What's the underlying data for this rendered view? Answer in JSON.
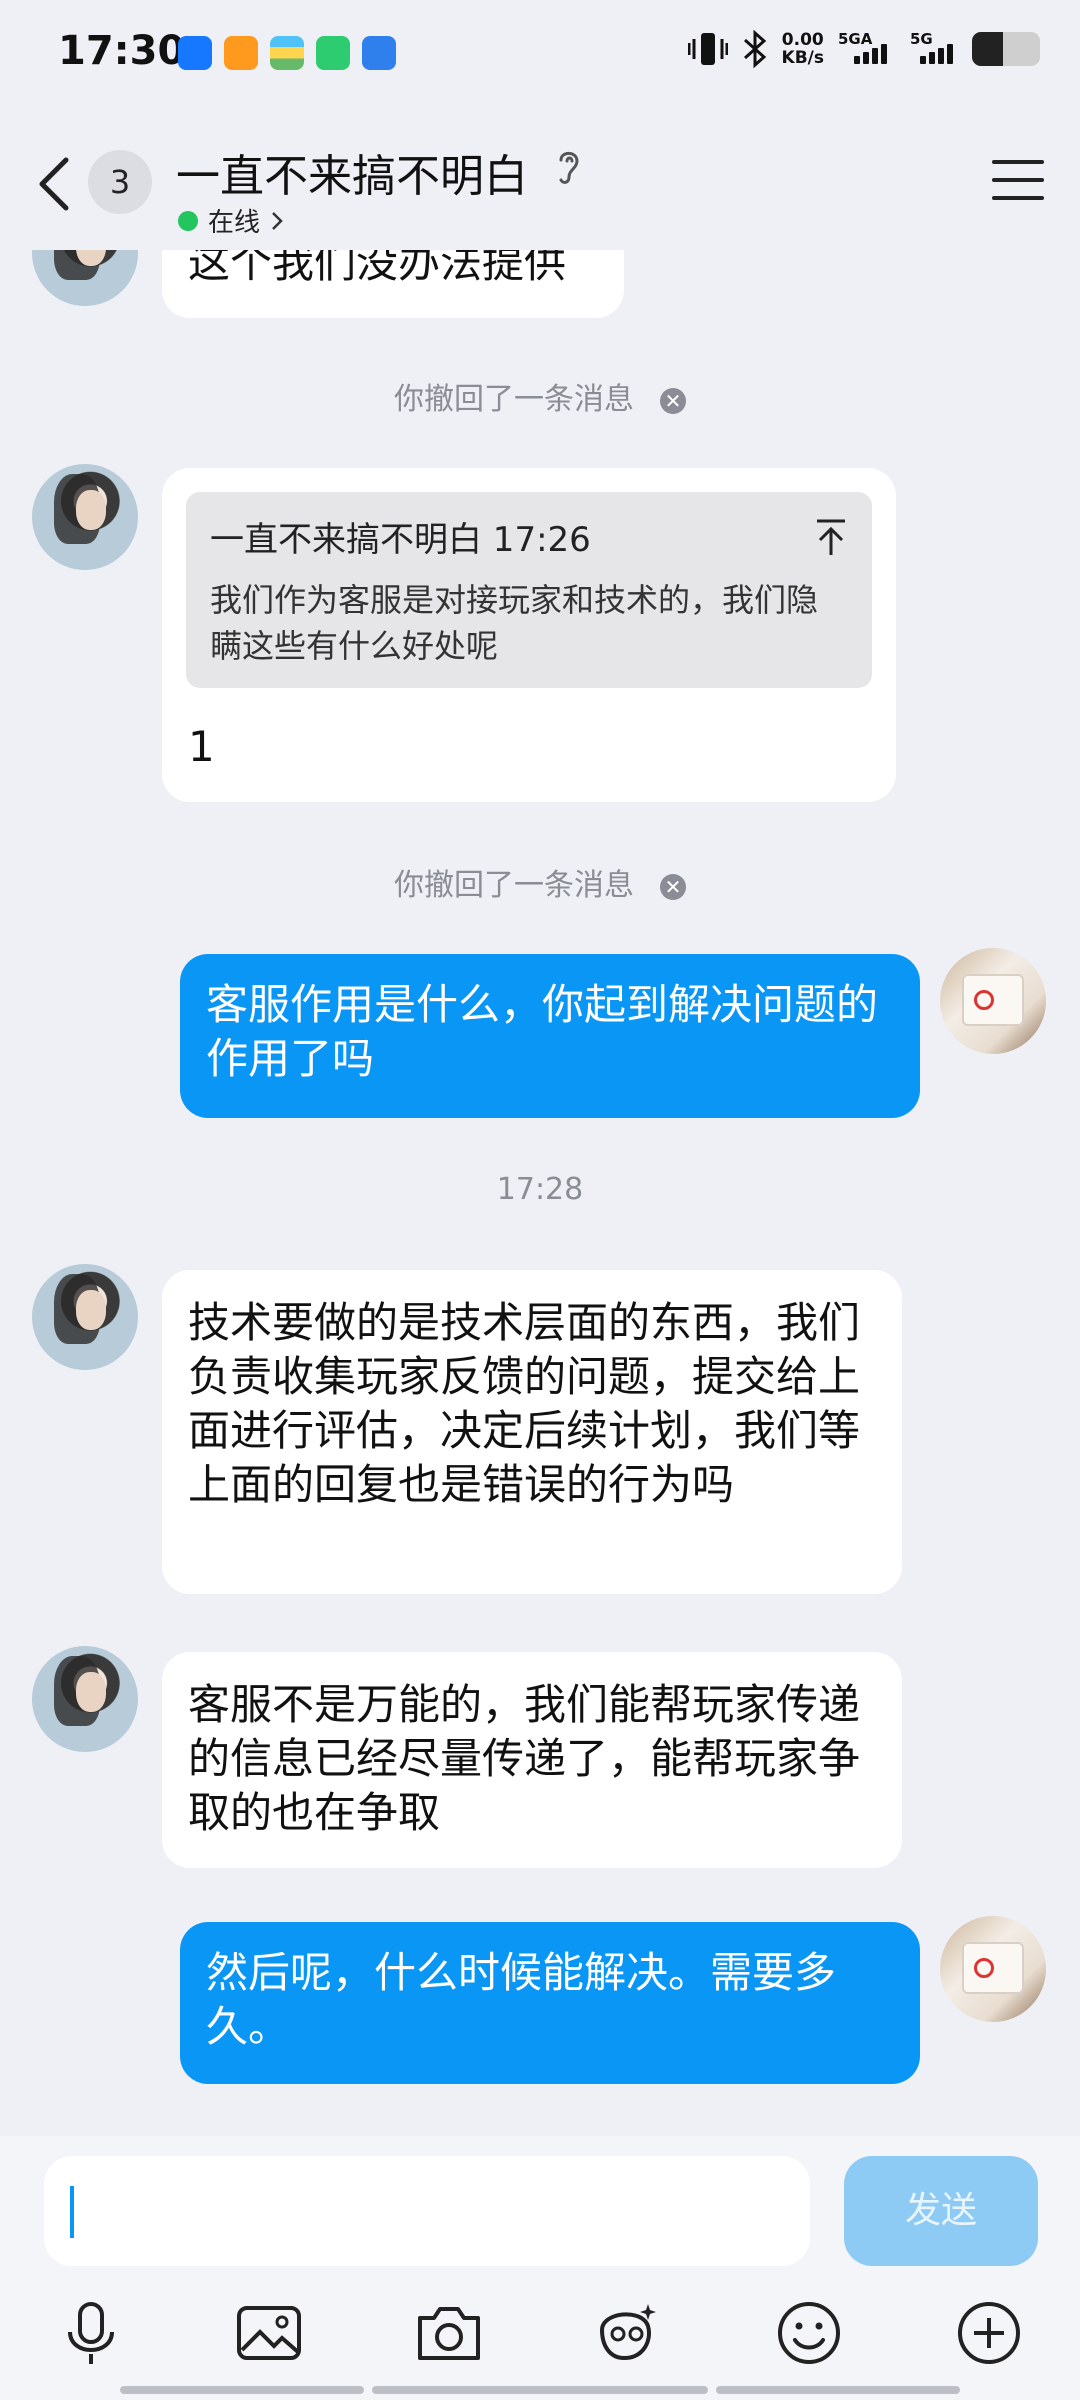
{
  "status_bar": {
    "time": "17:30",
    "speed_top": "0.00",
    "speed_bottom": "KB/s",
    "signal1_label": "5GA",
    "signal2_label": "5G",
    "battery_level": 0.45
  },
  "header": {
    "unread_count": "3",
    "title": "一直不来搞不明白",
    "status": "在线"
  },
  "messages": [
    {
      "text": "这个我们没办法提供"
    },
    {
      "system": "你撤回了一条消息"
    },
    {
      "quote": {
        "author_time": "一直不来搞不明白 17:26",
        "text": "我们作为客服是对接玩家和技术的，我们隐瞒这些有什么好处呢"
      },
      "text": "1"
    },
    {
      "system": "你撤回了一条消息"
    },
    {
      "text": "客服作用是什么，你起到解决问题的作用了吗"
    },
    {
      "time": "17:28"
    },
    {
      "text": "技术要做的是技术层面的东西，我们负责收集玩家反馈的问题，提交给上面进行评估，决定后续计划，我们等上面的回复也是错误的行为吗"
    },
    {
      "text": "客服不是万能的，我们能帮玩家传递的信息已经尽量传递了，能帮玩家争取的也在争取"
    },
    {
      "text": "然后呢，什么时候能解决。需要多久。"
    }
  ],
  "input": {
    "value": "",
    "send_label": "发送"
  },
  "colors": {
    "accent": "#0a96f5",
    "send_disabled": "#8dcbf5",
    "online": "#22c55e",
    "background": "#eef0f5"
  },
  "toolbar_icons": [
    "microphone-icon",
    "image-icon",
    "camera-icon",
    "ai-avatar-icon",
    "emoji-icon",
    "plus-icon"
  ]
}
